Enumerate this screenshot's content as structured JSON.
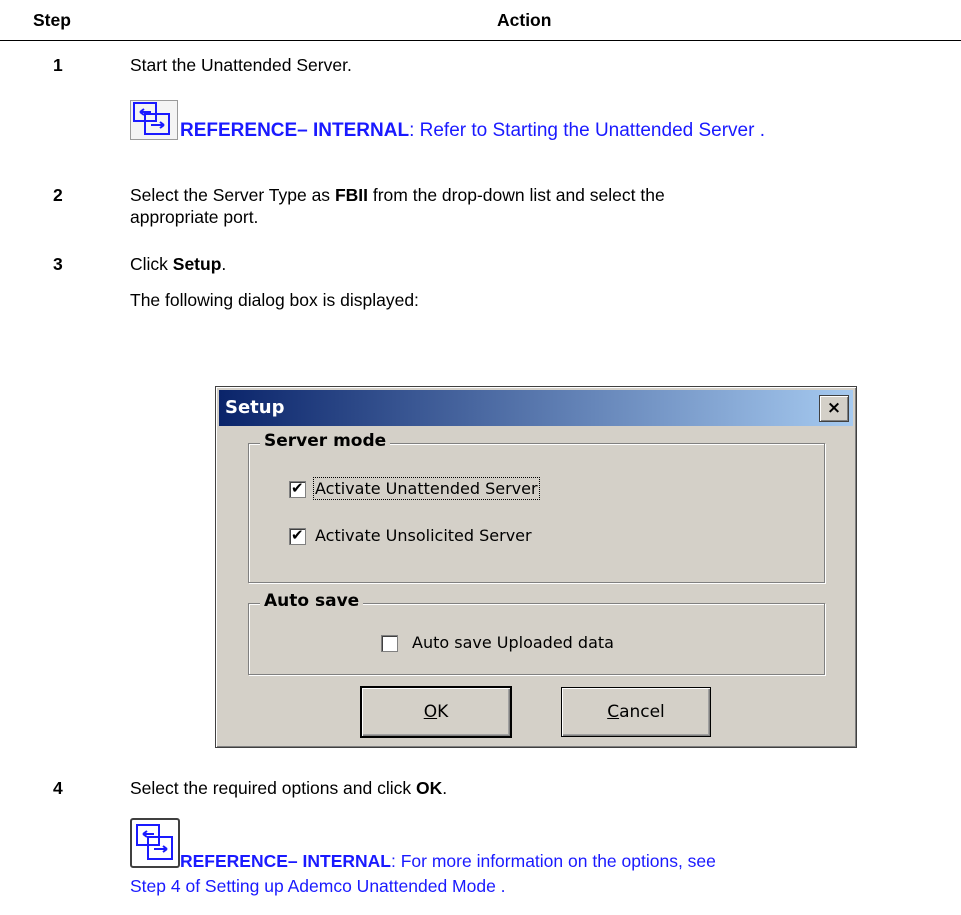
{
  "header": {
    "step": "Step",
    "action": "Action"
  },
  "steps": [
    {
      "num": "1",
      "text": "Start the Unattended Server."
    },
    {
      "num": "2",
      "text_pre": "Select the Server Type as ",
      "text_bold": "FBII",
      "text_post": " from the drop-down list and select the",
      "text_line2": "appropriate port."
    },
    {
      "num": "3",
      "text_pre": "Click ",
      "text_bold": "Setup",
      "text_post": ".",
      "sub": "The following dialog box is displayed:"
    },
    {
      "num": "4",
      "text_pre": "Select the required options and click ",
      "text_bold": "OK",
      "text_post": "."
    }
  ],
  "ref1": {
    "label": "REFERENCE– INTERNAL",
    "text": ": Refer to  Starting the Unattended Server ."
  },
  "ref2": {
    "label": "REFERENCE– INTERNAL",
    "text": ": For more information on the options, see",
    "line2": "Step 4 of  Setting up Ademco Unattended Mode ."
  },
  "dialog": {
    "title": "Setup",
    "close": "×",
    "group1": {
      "title": "Server mode",
      "items": [
        {
          "label": "Activate Unattended Server",
          "checked": true
        },
        {
          "label": "Activate Unsolicited Server",
          "checked": true
        }
      ]
    },
    "group2": {
      "title": "Auto save",
      "items": [
        {
          "label": "Auto save Uploaded data",
          "checked": false
        }
      ]
    },
    "ok": {
      "mnemonic": "O",
      "rest": "K"
    },
    "cancel": {
      "mnemonic": "C",
      "rest": "ancel"
    }
  },
  "colors": {
    "link": "#1a1aff",
    "titlebar_start": "#0a246a",
    "titlebar_end": "#a6caf0",
    "dialog_bg": "#d4d0c8"
  },
  "icons": [
    "reference-icon"
  ]
}
